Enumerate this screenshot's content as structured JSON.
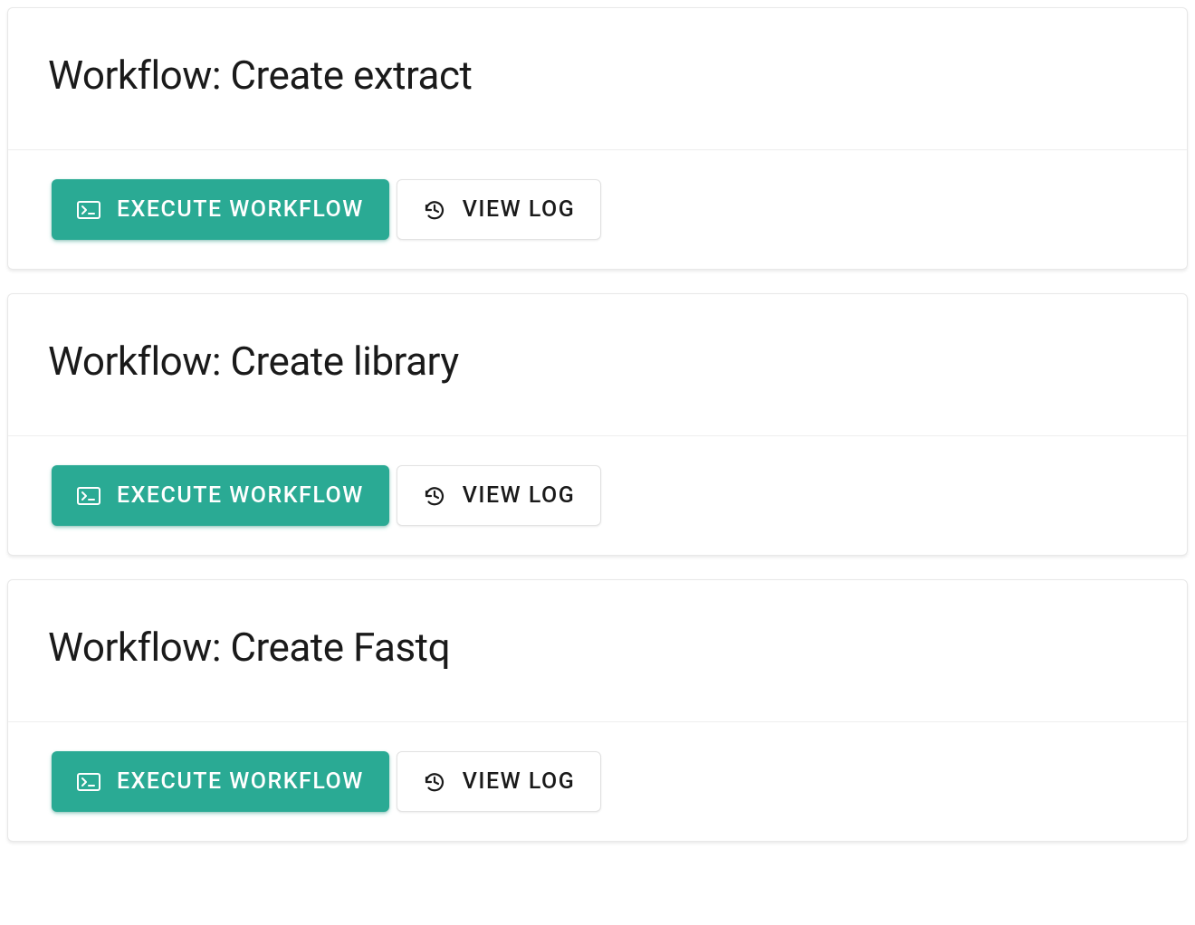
{
  "workflows": [
    {
      "title": "Workflow: Create extract",
      "execute_label": "EXECUTE WORKFLOW",
      "view_log_label": "VIEW LOG"
    },
    {
      "title": "Workflow: Create library",
      "execute_label": "EXECUTE WORKFLOW",
      "view_log_label": "VIEW LOG"
    },
    {
      "title": "Workflow: Create Fastq",
      "execute_label": "EXECUTE WORKFLOW",
      "view_log_label": "VIEW LOG"
    }
  ]
}
